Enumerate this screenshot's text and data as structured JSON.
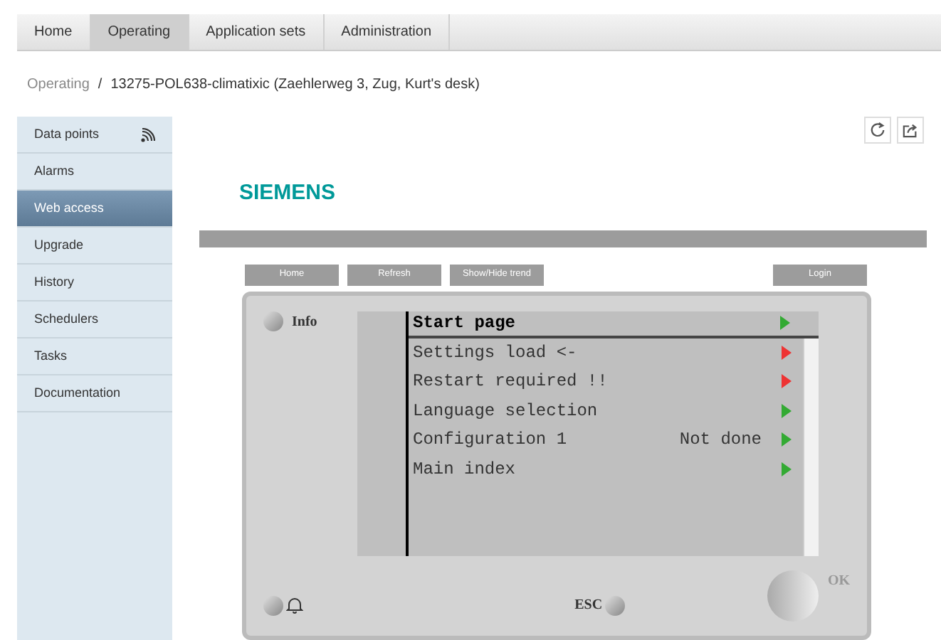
{
  "tabs": [
    {
      "label": "Home",
      "selected": false
    },
    {
      "label": "Operating",
      "selected": true
    },
    {
      "label": "Application sets",
      "selected": false
    },
    {
      "label": "Administration",
      "selected": false
    }
  ],
  "breadcrumb": [
    "Operating",
    "13275-POL638-climatixic (Zaehlerweg 3, Zug, Kurt's desk)"
  ],
  "breadcrumb_separator": "/",
  "sidebar": {
    "items": [
      {
        "label": "Data points",
        "selected": false,
        "kind": "feed"
      },
      {
        "label": "Alarms",
        "selected": false,
        "kind": "plain"
      },
      {
        "label": "Web access",
        "selected": true,
        "kind": "plain"
      },
      {
        "label": "Upgrade",
        "selected": false,
        "kind": "plain"
      },
      {
        "label": "History",
        "selected": false,
        "kind": "plain"
      },
      {
        "label": "Schedulers",
        "selected": false,
        "kind": "plain"
      },
      {
        "label": "Tasks",
        "selected": false,
        "kind": "plain"
      },
      {
        "label": "Documentation",
        "selected": false,
        "kind": "plain"
      }
    ]
  },
  "logo": "SIEMENS",
  "toolbar": {
    "left": [
      "Home",
      "Refresh",
      "Show/Hide trend"
    ],
    "right": [
      "Login"
    ]
  },
  "device": {
    "info_label": "Info",
    "esc_label": "ESC",
    "ok_label": "OK",
    "title": {
      "text": "Start page",
      "color": "#33aa33"
    },
    "menu": [
      {
        "label": "Settings load <-",
        "color": "#ee3333"
      },
      {
        "label": "Restart required !!",
        "color": "#ee3333"
      },
      {
        "label": "Language selection",
        "color": "#33aa33"
      },
      {
        "label": "Configuration 1",
        "value": "Not done",
        "color": "#33aa33"
      },
      {
        "label": "Main index",
        "color": "#33aa33"
      }
    ]
  }
}
